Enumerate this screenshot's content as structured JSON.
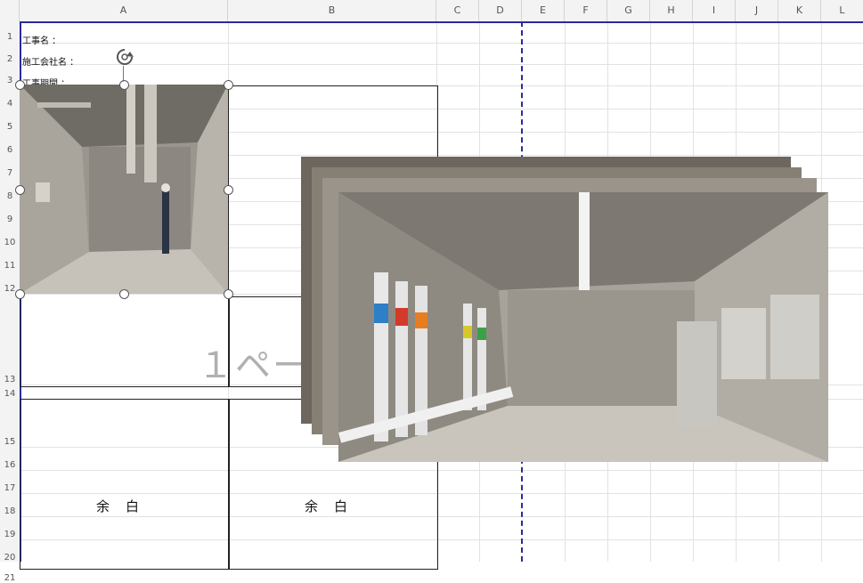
{
  "columns": [
    "A",
    "B",
    "C",
    "D",
    "E",
    "F",
    "G",
    "H",
    "I",
    "J",
    "K",
    "L"
  ],
  "rows": [
    "1",
    "2",
    "3",
    "4",
    "5",
    "6",
    "7",
    "8",
    "9",
    "10",
    "11",
    "12",
    "13",
    "14",
    "15",
    "16",
    "17",
    "18",
    "19",
    "20",
    "21"
  ],
  "cells": {
    "a1": "工事名 ：",
    "a2": "施工会社名 ：",
    "a3": "工事期間 ："
  },
  "page_watermark": "１ページ",
  "blank_left": "余白",
  "blank_right": "余白",
  "images": {
    "selected": "concrete-room-photo",
    "stack": [
      "pipe-room-photo-1",
      "pipe-room-photo-2",
      "pipe-room-photo-3",
      "pipe-room-photo-4"
    ]
  },
  "colors": {
    "page_break": "#2a2aa0",
    "header_bg": "#f3f3f3",
    "gridline": "#e2e2e2"
  }
}
